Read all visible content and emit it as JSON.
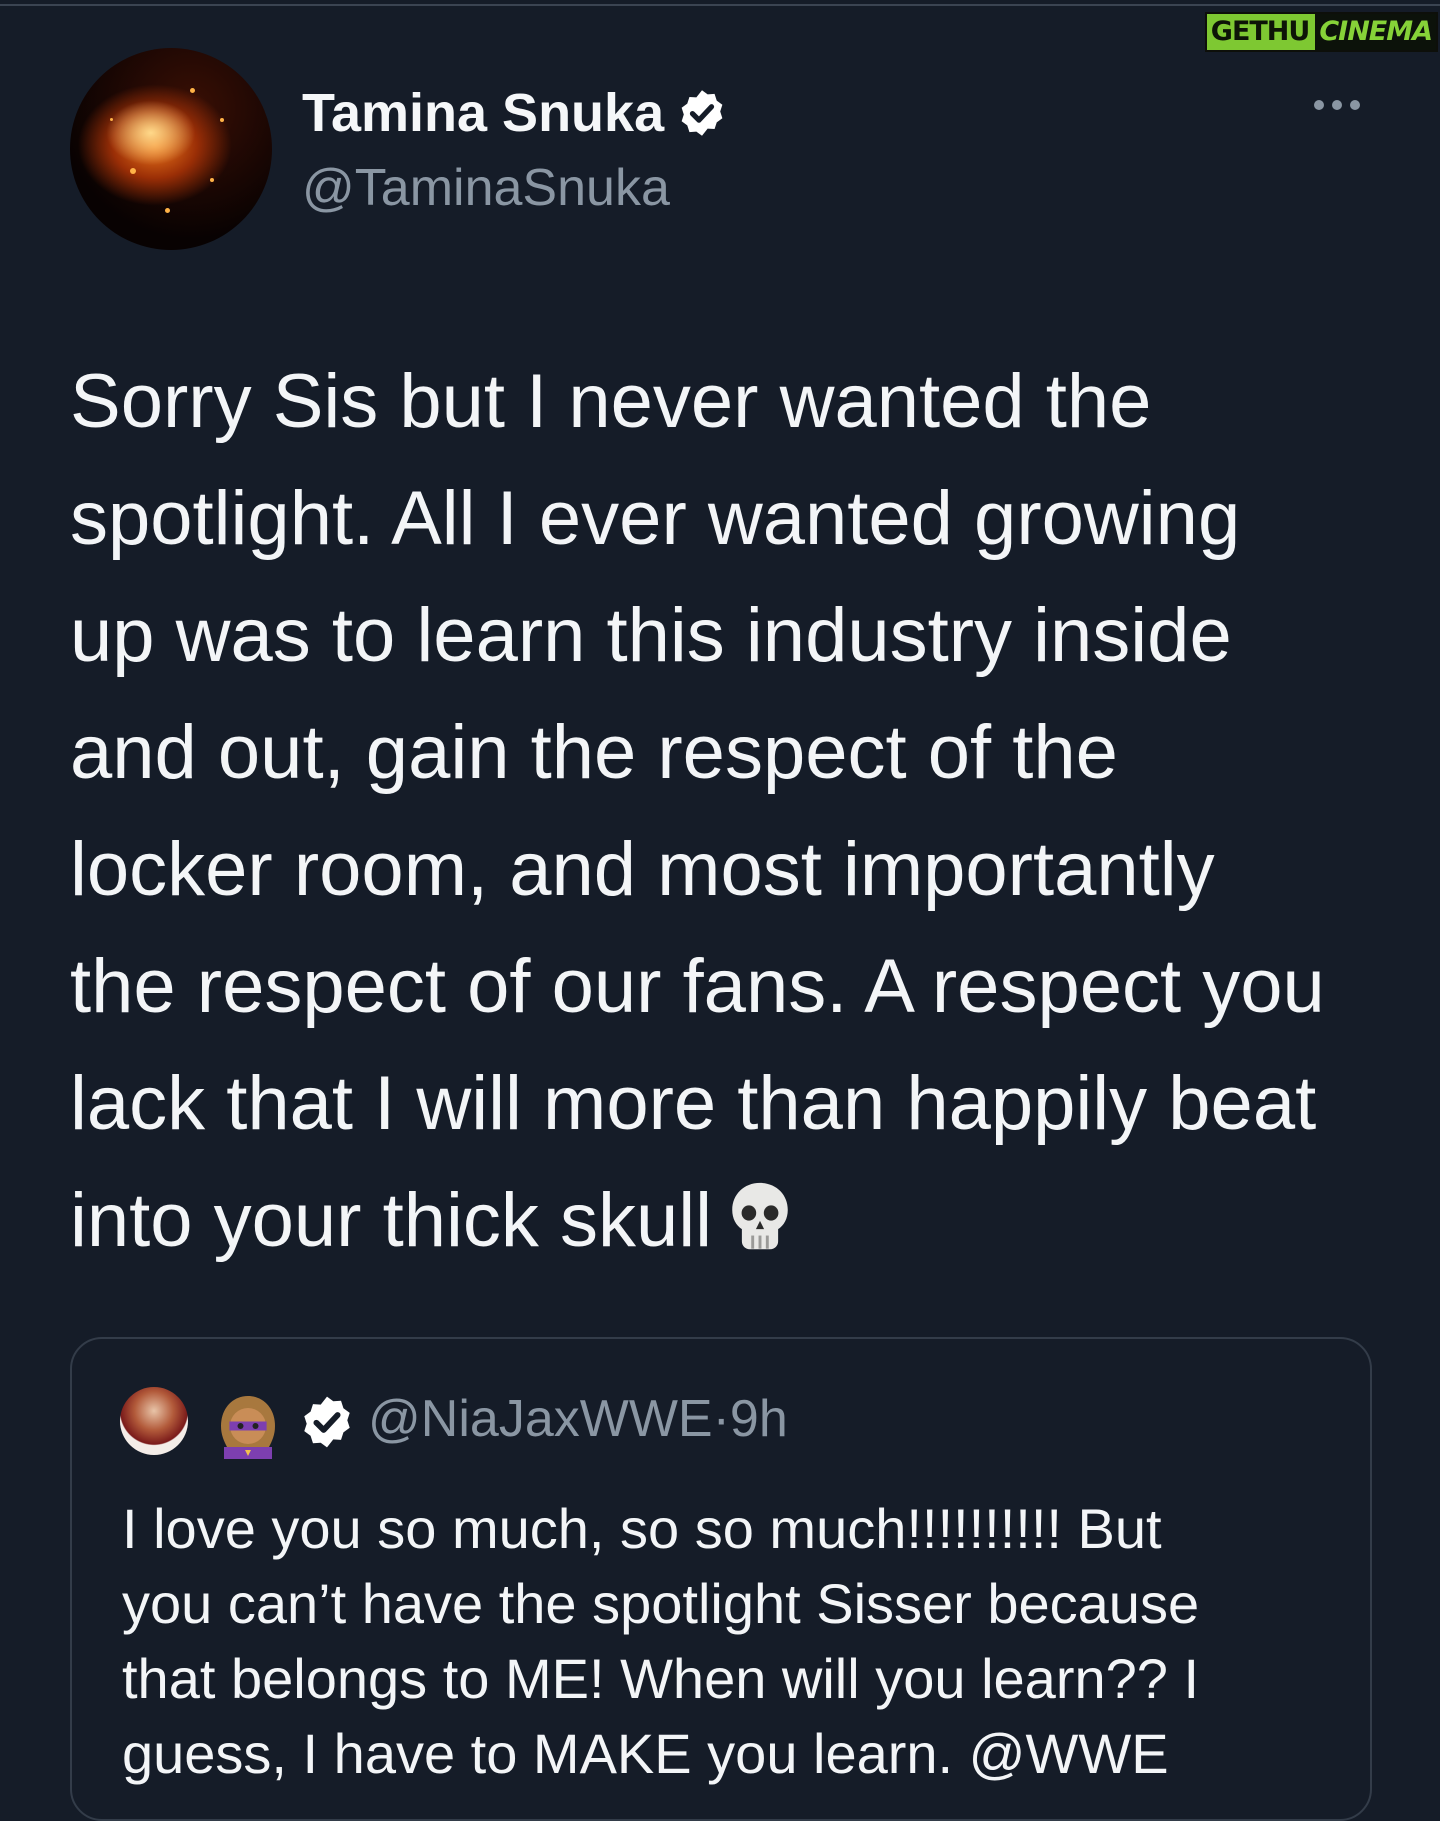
{
  "watermark": {
    "part_a": "GETHU",
    "part_b": "CINEMA"
  },
  "author": {
    "display_name": "Tamina Snuka",
    "handle": "@TaminaSnuka"
  },
  "tweet": {
    "lines": [
      "Sorry Sis but I never wanted the",
      "spotlight. All I ever wanted growing",
      "up was to learn this industry inside",
      "and out, gain the respect of the",
      "locker room, and most importantly",
      "the respect of our fans. A respect you",
      "lack that I will more than happily beat",
      "into your thick skull"
    ]
  },
  "quoted_tweet": {
    "handle": "@NiaJaxWWE",
    "separator": "·",
    "time": "9h",
    "lines": [
      "I love you so much, so so much!!!!!!!!!! But",
      "you can’t have the spotlight Sisser because",
      "that belongs to ME! When will you learn?? I",
      "guess, I have to MAKE you learn. @WWE"
    ]
  },
  "icons": [
    "verified-badge-icon",
    "more-options-icon",
    "skull-emoji-icon",
    "superhero-emoji-icon"
  ],
  "colors": {
    "background": "#151c28",
    "text": "#f3f5f7",
    "secondary_text": "#8a96a3",
    "card_border": "#333c49",
    "watermark_green": "#7ec832"
  }
}
